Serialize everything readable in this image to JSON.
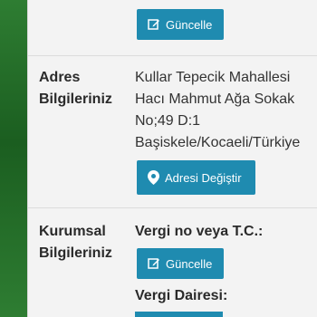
{
  "top": {
    "update_button_label": "Güncelle"
  },
  "address": {
    "label": "Adres Bilgileriniz",
    "lines": [
      "Kullar Tepecik Mahallesi",
      "Hacı Mahmut Ağa Sokak",
      "No;49 D:1",
      "Başiskele/Kocaeli/Türkiye"
    ],
    "change_button_label": "Adresi Değiştir"
  },
  "corporate": {
    "label": "Kurumsal Bilgileriniz",
    "tax_no_label": "Vergi no veya T.C.:",
    "update_button_label": "Güncelle",
    "tax_office_label": "Vergi Dairesi:"
  },
  "colors": {
    "button": "#1f8bb0",
    "sidebar_green": "#2e7d32"
  }
}
